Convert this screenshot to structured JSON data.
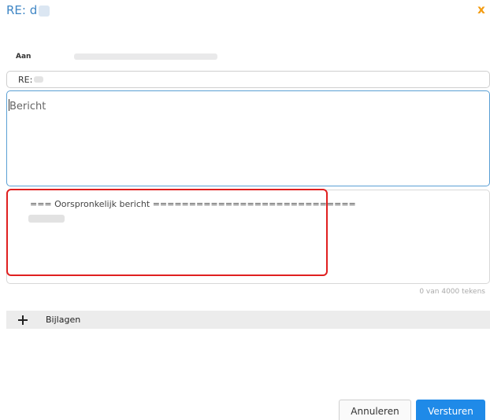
{
  "dialog": {
    "title": "RE: d"
  },
  "to": {
    "label": "Aan"
  },
  "subject": {
    "value": "RE:"
  },
  "message": {
    "placeholder": "Bericht"
  },
  "original": {
    "header": "=== Oorspronkelijk bericht ============================"
  },
  "counter": {
    "text": "0 van 4000 tekens"
  },
  "attachments": {
    "label": "Bijlagen"
  },
  "buttons": {
    "cancel": "Annuleren",
    "send": "Versturen"
  },
  "colors": {
    "title": "#3f86c5",
    "close": "#f39c12",
    "send": "#1f8ae8",
    "highlight": "#e02020"
  },
  "icons": {
    "close": "close-icon",
    "add": "plus-icon"
  }
}
